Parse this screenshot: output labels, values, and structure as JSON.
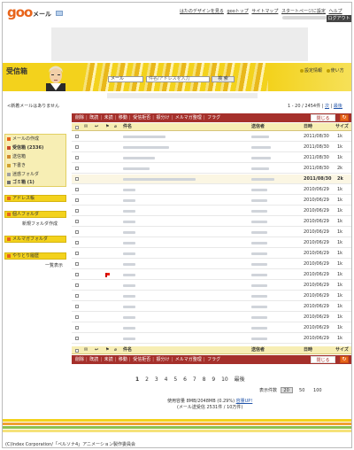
{
  "header": {
    "logo": "goo",
    "logo_sub": "メール",
    "top_links": [
      "はたのデザインを見る",
      "gooトップ",
      "サイトマップ",
      "スタートページに設定",
      "ヘルプ"
    ],
    "logout": "ログアウト"
  },
  "banner": {
    "title": "受信箱",
    "folder_select": "メール",
    "search_placeholder": "件名/アドレスを入力",
    "search_button": "検 索",
    "link_settings": "設定情報",
    "link_usage": "使い方"
  },
  "status": {
    "new_mail": "<新着メールはありません",
    "page_count": "1 - 20 / 2454件",
    "next": "次",
    "last": "最後"
  },
  "sidebar": {
    "mail_create": "メールの作成",
    "folders": [
      {
        "label": "受信箱 (2336)"
      },
      {
        "label": "送信箱"
      },
      {
        "label": "下書き"
      },
      {
        "label": "迷惑フォルダ"
      },
      {
        "label": "ゴミ箱 (1)"
      }
    ],
    "sections": [
      {
        "label": "アドレス帳"
      },
      {
        "label": "個人フォルダ"
      },
      {
        "label": "メルマガフォルダ"
      },
      {
        "label": "やりとり履歴"
      }
    ],
    "new_folder": "新規フォルダ作成",
    "list_view": "一覧表示"
  },
  "toolbar": {
    "actions": [
      "削除",
      "既読",
      "未読",
      "移動",
      "受信拒否",
      "振分け",
      "メルマガ整理",
      "フラグ"
    ],
    "close_button": "閉じる"
  },
  "table": {
    "headers": {
      "subject": "件名",
      "sender": "送信者",
      "date": "日時",
      "size": "サイズ"
    },
    "rows": [
      {
        "date": "2011/08/30",
        "size": "1k",
        "highlight": false,
        "flag": false
      },
      {
        "date": "2011/08/30",
        "size": "1k",
        "highlight": false,
        "flag": false
      },
      {
        "date": "2011/08/30",
        "size": "1k",
        "highlight": false,
        "flag": false
      },
      {
        "date": "2011/08/30",
        "size": "2k",
        "highlight": false,
        "flag": false
      },
      {
        "date": "2011/08/30",
        "size": "2k",
        "highlight": true,
        "flag": false
      },
      {
        "date": "2010/06/29",
        "size": "1k",
        "highlight": false,
        "flag": false
      },
      {
        "date": "2010/06/29",
        "size": "1k",
        "highlight": false,
        "flag": false
      },
      {
        "date": "2010/06/29",
        "size": "1k",
        "highlight": false,
        "flag": false
      },
      {
        "date": "2010/06/29",
        "size": "1k",
        "highlight": false,
        "flag": false
      },
      {
        "date": "2010/06/29",
        "size": "1k",
        "highlight": false,
        "flag": false
      },
      {
        "date": "2010/06/29",
        "size": "1k",
        "highlight": false,
        "flag": false
      },
      {
        "date": "2010/06/29",
        "size": "1k",
        "highlight": false,
        "flag": false
      },
      {
        "date": "2010/06/29",
        "size": "1k",
        "highlight": false,
        "flag": false
      },
      {
        "date": "2010/06/29",
        "size": "1k",
        "highlight": false,
        "flag": true
      },
      {
        "date": "2010/06/29",
        "size": "1k",
        "highlight": false,
        "flag": false
      },
      {
        "date": "2010/06/29",
        "size": "1k",
        "highlight": false,
        "flag": false
      },
      {
        "date": "2010/06/29",
        "size": "1k",
        "highlight": false,
        "flag": false
      },
      {
        "date": "2010/06/29",
        "size": "1k",
        "highlight": false,
        "flag": false
      },
      {
        "date": "2010/06/29",
        "size": "1k",
        "highlight": false,
        "flag": false
      },
      {
        "date": "2010/06/29",
        "size": "1k",
        "highlight": false,
        "flag": false
      }
    ]
  },
  "pager": {
    "pages": [
      "1",
      "2",
      "3",
      "4",
      "5",
      "6",
      "7",
      "8",
      "9",
      "10"
    ],
    "last": "最後"
  },
  "display_count": {
    "label": "表示件数",
    "options": [
      "20",
      "50",
      "100"
    ],
    "selected": "20"
  },
  "usage": {
    "line1": "使用容量 8MB/2048MB (0.29%)",
    "upgrade": "容量UP!",
    "line2": "(メール送受信 2531件 / 10万件)"
  },
  "colors": {
    "accent_yellow": "#f3d21c",
    "toolbar_red": "#a5302b",
    "logo_orange": "#e8641b"
  },
  "copyright": "(C)Index Corporation/「ペルソナ4」アニメーション製作委員会"
}
